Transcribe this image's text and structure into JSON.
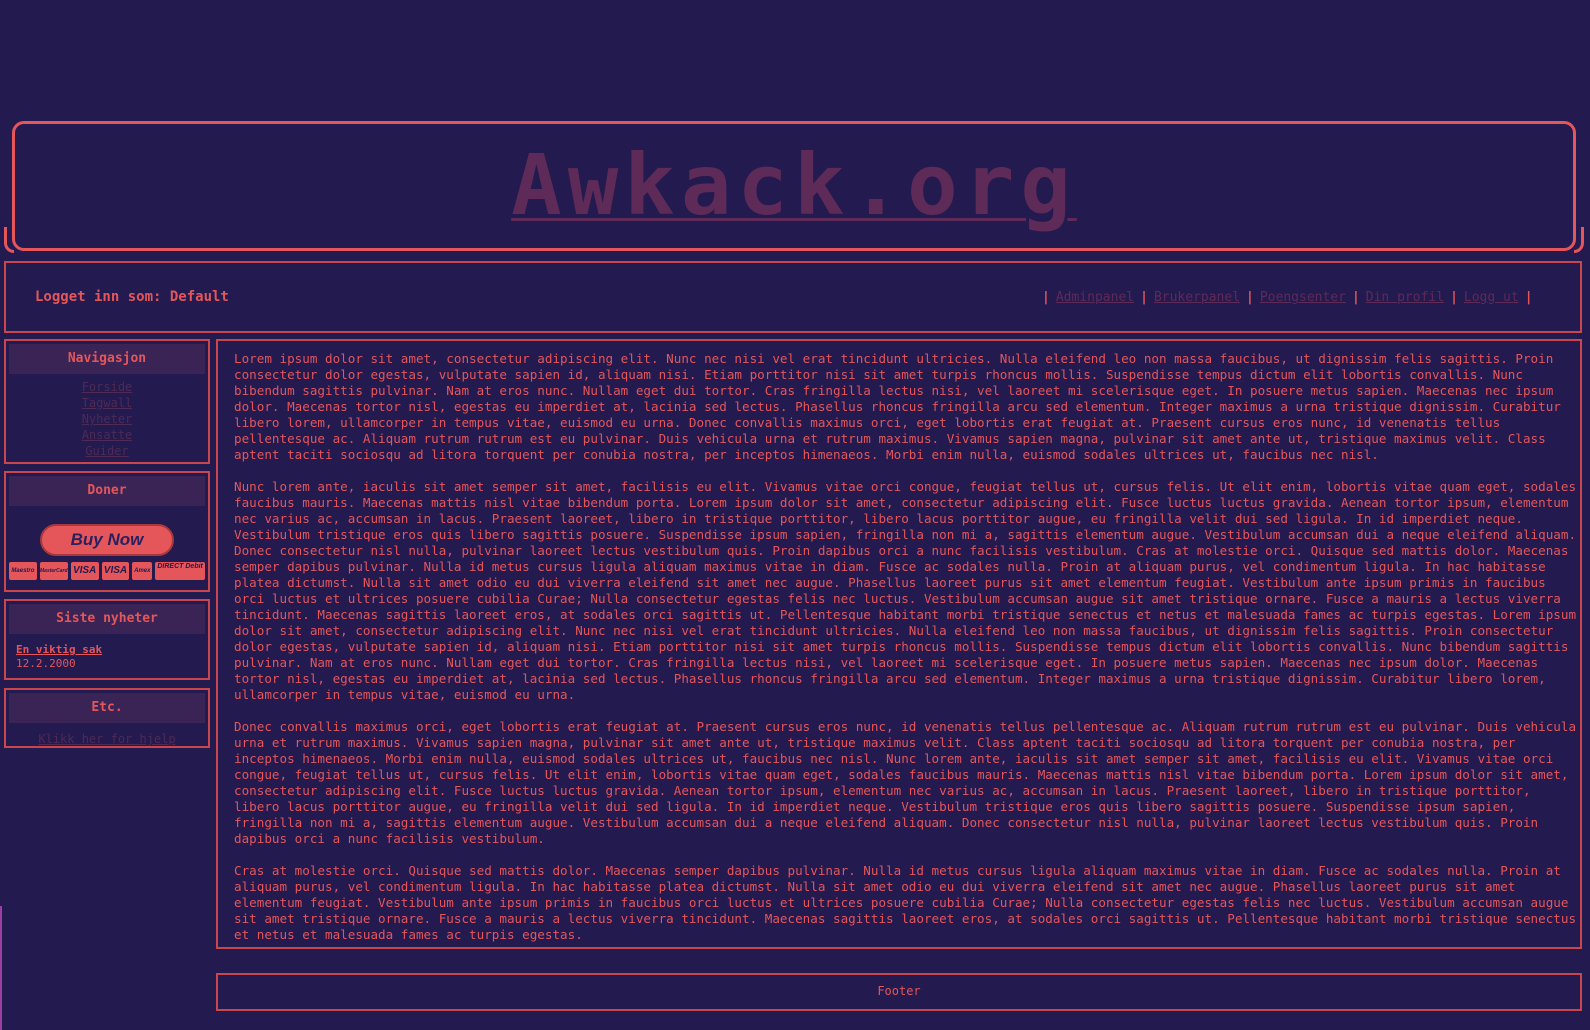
{
  "header": {
    "logo_text": "Awkack.org"
  },
  "userbar": {
    "login_text": "Logget inn som: Default",
    "links": [
      "Adminpanel",
      "Brukerpanel",
      "Poengsenter",
      "Din profil",
      "Logg ut"
    ],
    "separator": "|"
  },
  "sidebar": {
    "navigation": {
      "title": "Navigasjon",
      "items": [
        "Forside",
        "Tagwall",
        "Nyheter",
        "Ansatte",
        "Guider"
      ]
    },
    "donate": {
      "title": "Doner",
      "button_label": "Buy Now",
      "cards": [
        "Maestro",
        "MasterCard",
        "VISA",
        "VISA",
        "Amex",
        "DIRECT Debit"
      ]
    },
    "news": {
      "title": "Siste nyheter",
      "item_title": "En viktig sak",
      "item_date": "12.2.2000"
    },
    "etc": {
      "title": "Etc.",
      "help_link": "Klikk her for hjelp"
    }
  },
  "content": {
    "paragraphs": [
      "Lorem ipsum dolor sit amet, consectetur adipiscing elit. Nunc nec nisi vel erat tincidunt ultricies. Nulla eleifend leo non massa faucibus, ut dignissim felis sagittis. Proin consectetur dolor egestas, vulputate sapien id, aliquam nisi. Etiam porttitor nisi sit amet turpis rhoncus mollis. Suspendisse tempus dictum elit lobortis convallis. Nunc bibendum sagittis pulvinar. Nam at eros nunc. Nullam eget dui tortor. Cras fringilla lectus nisi, vel laoreet mi scelerisque eget. In posuere metus sapien. Maecenas nec ipsum dolor. Maecenas tortor nisl, egestas eu imperdiet at, lacinia sed lectus. Phasellus rhoncus fringilla arcu sed elementum. Integer maximus a urna tristique dignissim. Curabitur libero lorem, ullamcorper in tempus vitae, euismod eu urna. Donec convallis maximus orci, eget lobortis erat feugiat at. Praesent cursus eros nunc, id venenatis tellus pellentesque ac. Aliquam rutrum rutrum est eu pulvinar. Duis vehicula urna et rutrum maximus. Vivamus sapien magna, pulvinar sit amet ante ut, tristique maximus velit. Class aptent taciti sociosqu ad litora torquent per conubia nostra, per inceptos himenaeos. Morbi enim nulla, euismod sodales ultrices ut, faucibus nec nisl.",
      "Nunc lorem ante, iaculis sit amet semper sit amet, facilisis eu elit. Vivamus vitae orci congue, feugiat tellus ut, cursus felis. Ut elit enim, lobortis vitae quam eget, sodales faucibus mauris. Maecenas mattis nisl vitae bibendum porta. Lorem ipsum dolor sit amet, consectetur adipiscing elit. Fusce luctus luctus gravida. Aenean tortor ipsum, elementum nec varius ac, accumsan in lacus. Praesent laoreet, libero in tristique porttitor, libero lacus porttitor augue, eu fringilla velit dui sed ligula. In id imperdiet neque. Vestibulum tristique eros quis libero sagittis posuere. Suspendisse ipsum sapien, fringilla non mi a, sagittis elementum augue. Vestibulum accumsan dui a neque eleifend aliquam. Donec consectetur nisl nulla, pulvinar laoreet lectus vestibulum quis. Proin dapibus orci a nunc facilisis vestibulum. Cras at molestie orci. Quisque sed mattis dolor. Maecenas semper dapibus pulvinar. Nulla id metus cursus ligula aliquam maximus vitae in diam. Fusce ac sodales nulla. Proin at aliquam purus, vel condimentum ligula. In hac habitasse platea dictumst. Nulla sit amet odio eu dui viverra eleifend sit amet nec augue. Phasellus laoreet purus sit amet elementum feugiat. Vestibulum ante ipsum primis in faucibus orci luctus et ultrices posuere cubilia Curae; Nulla consectetur egestas felis nec luctus. Vestibulum accumsan augue sit amet tristique ornare. Fusce a mauris a lectus viverra tincidunt. Maecenas sagittis laoreet eros, at sodales orci sagittis ut. Pellentesque habitant morbi tristique senectus et netus et malesuada fames ac turpis egestas. Lorem ipsum dolor sit amet, consectetur adipiscing elit. Nunc nec nisi vel erat tincidunt ultricies. Nulla eleifend leo non massa faucibus, ut dignissim felis sagittis. Proin consectetur dolor egestas, vulputate sapien id, aliquam nisi. Etiam porttitor nisi sit amet turpis rhoncus mollis. Suspendisse tempus dictum elit lobortis convallis. Nunc bibendum sagittis pulvinar. Nam at eros nunc. Nullam eget dui tortor. Cras fringilla lectus nisi, vel laoreet mi scelerisque eget. In posuere metus sapien. Maecenas nec ipsum dolor. Maecenas tortor nisl, egestas eu imperdiet at, lacinia sed lectus. Phasellus rhoncus fringilla arcu sed elementum. Integer maximus a urna tristique dignissim. Curabitur libero lorem, ullamcorper in tempus vitae, euismod eu urna.",
      "Donec convallis maximus orci, eget lobortis erat feugiat at. Praesent cursus eros nunc, id venenatis tellus pellentesque ac. Aliquam rutrum rutrum est eu pulvinar. Duis vehicula urna et rutrum maximus. Vivamus sapien magna, pulvinar sit amet ante ut, tristique maximus velit. Class aptent taciti sociosqu ad litora torquent per conubia nostra, per inceptos himenaeos. Morbi enim nulla, euismod sodales ultrices ut, faucibus nec nisl. Nunc lorem ante, iaculis sit amet semper sit amet, facilisis eu elit. Vivamus vitae orci congue, feugiat tellus ut, cursus felis. Ut elit enim, lobortis vitae quam eget, sodales faucibus mauris. Maecenas mattis nisl vitae bibendum porta. Lorem ipsum dolor sit amet, consectetur adipiscing elit. Fusce luctus luctus gravida. Aenean tortor ipsum, elementum nec varius ac, accumsan in lacus. Praesent laoreet, libero in tristique porttitor, libero lacus porttitor augue, eu fringilla velit dui sed ligula. In id imperdiet neque. Vestibulum tristique eros quis libero sagittis posuere. Suspendisse ipsum sapien, fringilla non mi a, sagittis elementum augue. Vestibulum accumsan dui a neque eleifend aliquam. Donec consectetur nisl nulla, pulvinar laoreet lectus vestibulum quis. Proin dapibus orci a nunc facilisis vestibulum.",
      "Cras at molestie orci. Quisque sed mattis dolor. Maecenas semper dapibus pulvinar. Nulla id metus cursus ligula aliquam maximus vitae in diam. Fusce ac sodales nulla. Proin at aliquam purus, vel condimentum ligula. In hac habitasse platea dictumst. Nulla sit amet odio eu dui viverra eleifend sit amet nec augue. Phasellus laoreet purus sit amet elementum feugiat. Vestibulum ante ipsum primis in faucibus orci luctus et ultrices posuere cubilia Curae; Nulla consectetur egestas felis nec luctus. Vestibulum accumsan augue sit amet tristique ornare. Fusce a mauris a lectus viverra tincidunt. Maecenas sagittis laoreet eros, at sodales orci sagittis ut. Pellentesque habitant morbi tristique senectus et netus et malesuada fames ac turpis egestas."
    ]
  },
  "footer": {
    "text": "Footer"
  },
  "colors": {
    "background": "#231a50",
    "accent": "#e4565a",
    "link_dim": "#5e2a57"
  }
}
